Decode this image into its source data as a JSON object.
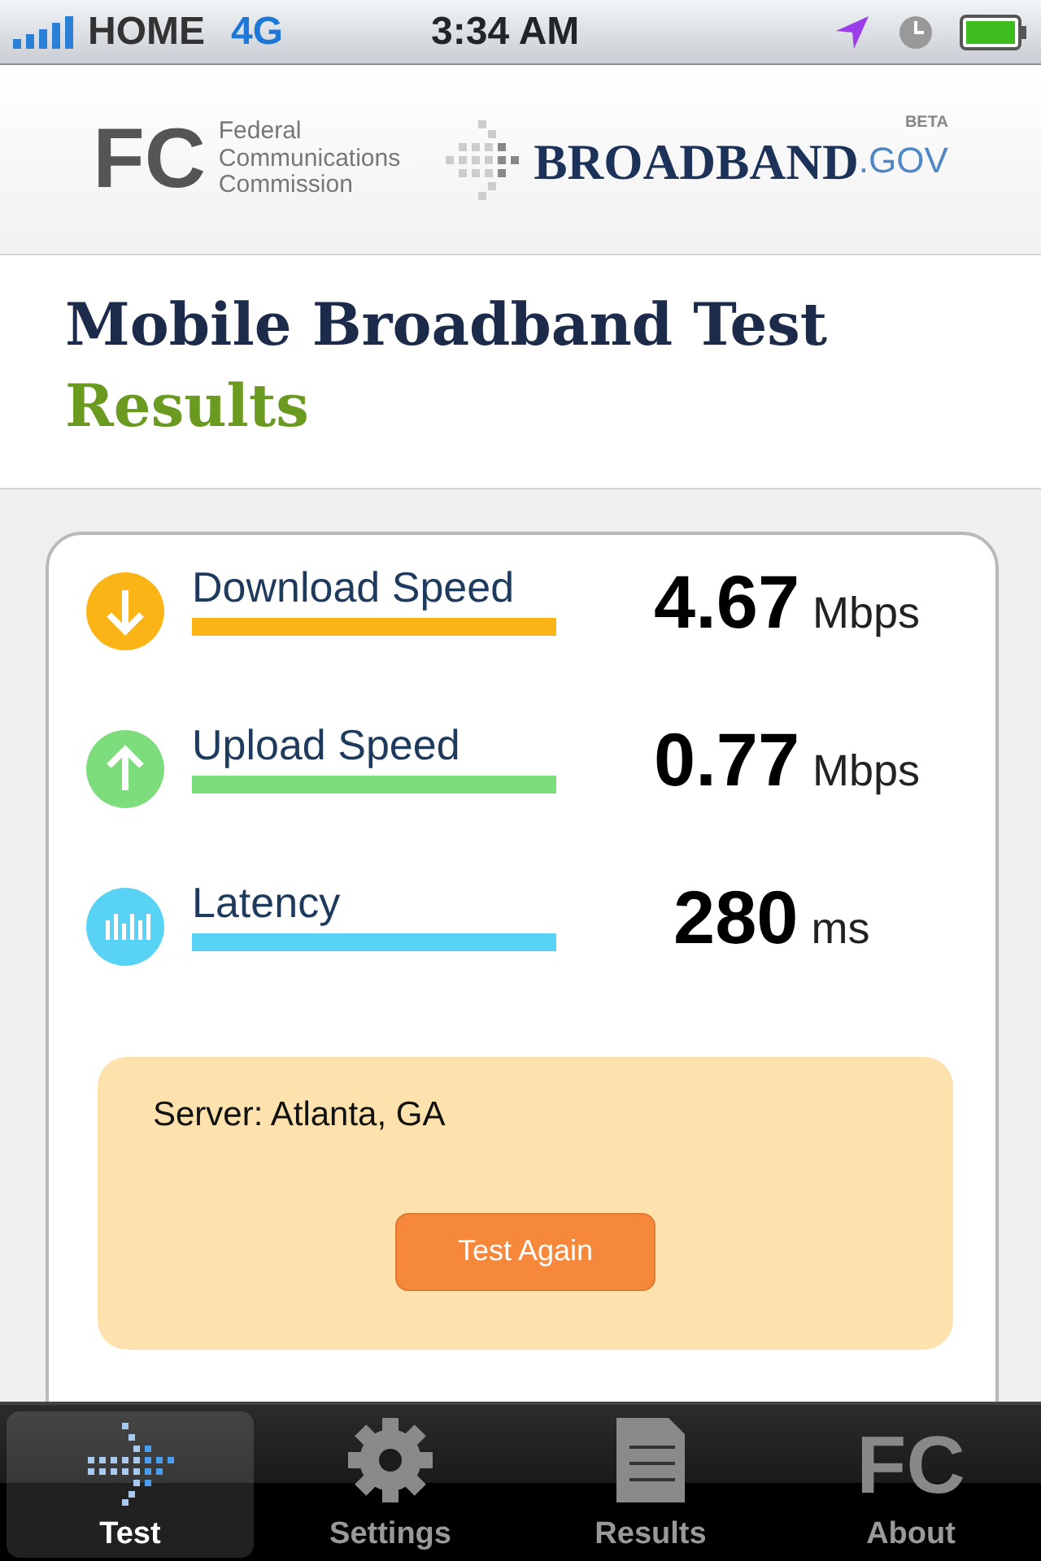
{
  "status_bar": {
    "carrier": "HOME",
    "network": "4G",
    "time": "3:34 AM"
  },
  "header": {
    "fcc_mark": "FC",
    "fcc_name": [
      "Federal",
      "Communications",
      "Commission"
    ],
    "site_name": "BROADBAND",
    "site_suffix": ".GOV",
    "site_badge": "BETA"
  },
  "title": "Mobile Broadband Test",
  "subtitle": "Results",
  "metrics": [
    {
      "kind": "download",
      "label": "Download Speed",
      "value": "4.67",
      "unit": "Mbps",
      "color": "#fbb416"
    },
    {
      "kind": "upload",
      "label": "Upload Speed",
      "value": "0.77",
      "unit": "Mbps",
      "color": "#7ddc7c"
    },
    {
      "kind": "latency",
      "label": "Latency",
      "value": "280",
      "unit": "ms",
      "color": "#58d3f5"
    }
  ],
  "server": {
    "label": "Server: Atlanta, GA",
    "button": "Test Again"
  },
  "tabs": [
    {
      "label": "Test",
      "kind": "arrow",
      "selected": true
    },
    {
      "label": "Settings",
      "kind": "gear",
      "selected": false
    },
    {
      "label": "Results",
      "kind": "document",
      "selected": false
    },
    {
      "label": "About",
      "kind": "mark",
      "icon_text": "FC",
      "selected": false
    }
  ]
}
